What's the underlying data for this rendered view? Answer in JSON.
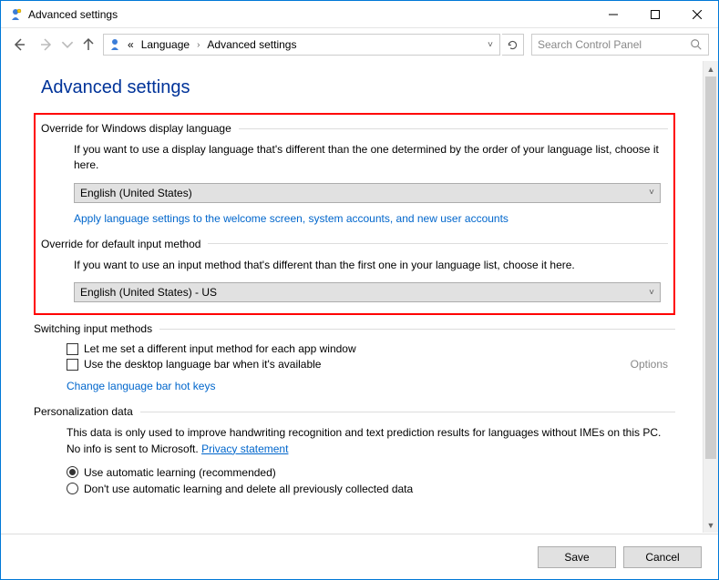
{
  "window": {
    "title": "Advanced settings"
  },
  "breadcrumb": {
    "level0": "«",
    "level1": "Language",
    "level2": "Advanced settings"
  },
  "search": {
    "placeholder": "Search Control Panel"
  },
  "page": {
    "heading": "Advanced settings"
  },
  "group_display": {
    "title": "Override for Windows display language",
    "desc": "If you want to use a display language that's different than the one determined by the order of your language list, choose it here.",
    "combo_value": "English (United States)",
    "link_text": "Apply language settings to the welcome screen, system accounts, and new user accounts"
  },
  "group_input": {
    "title": "Override for default input method",
    "desc": "If you want to use an input method that's different than the first one in your language list, choose it here.",
    "combo_value": "English (United States) - US"
  },
  "group_switch": {
    "title": "Switching input methods",
    "check1": "Let me set a different input method for each app window",
    "check2": "Use the desktop language bar when it's available",
    "options_label": "Options",
    "hotkeys_link": "Change language bar hot keys"
  },
  "group_personal": {
    "title": "Personalization data",
    "desc_prefix": "This data is only used to improve handwriting recognition and text prediction results for languages without IMEs on this PC. No info is sent to Microsoft. ",
    "privacy_link": "Privacy statement",
    "radio1": "Use automatic learning (recommended)",
    "radio2": "Don't use automatic learning and delete all previously collected data"
  },
  "footer": {
    "save": "Save",
    "cancel": "Cancel"
  }
}
